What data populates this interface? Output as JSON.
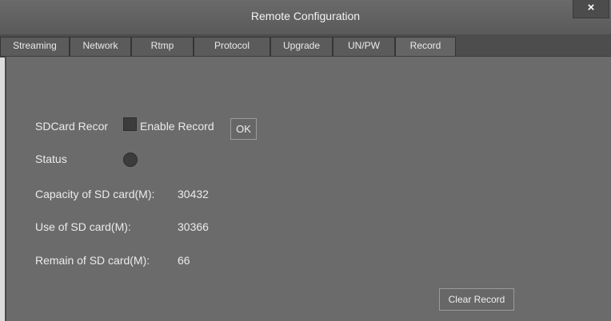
{
  "window": {
    "title": "Remote Configuration",
    "close_glyph": "×"
  },
  "tabs": [
    {
      "label": "Streaming"
    },
    {
      "label": "Network"
    },
    {
      "label": "Rtmp"
    },
    {
      "label": "Protocol"
    },
    {
      "label": "Upgrade"
    },
    {
      "label": "UN/PW"
    },
    {
      "label": "Record"
    }
  ],
  "active_tab": "Record",
  "record": {
    "sdcard_label": "SDCard Recor",
    "enable_checked": false,
    "enable_label": "Enable Record",
    "ok_label": "OK",
    "status_label": "Status",
    "capacity_label": "Capacity of SD card(M):",
    "capacity_value": "30432",
    "use_label": "Use of SD card(M):",
    "use_value": "30366",
    "remain_label": "Remain of SD card(M):",
    "remain_value": "66",
    "clear_label": "Clear Record"
  }
}
